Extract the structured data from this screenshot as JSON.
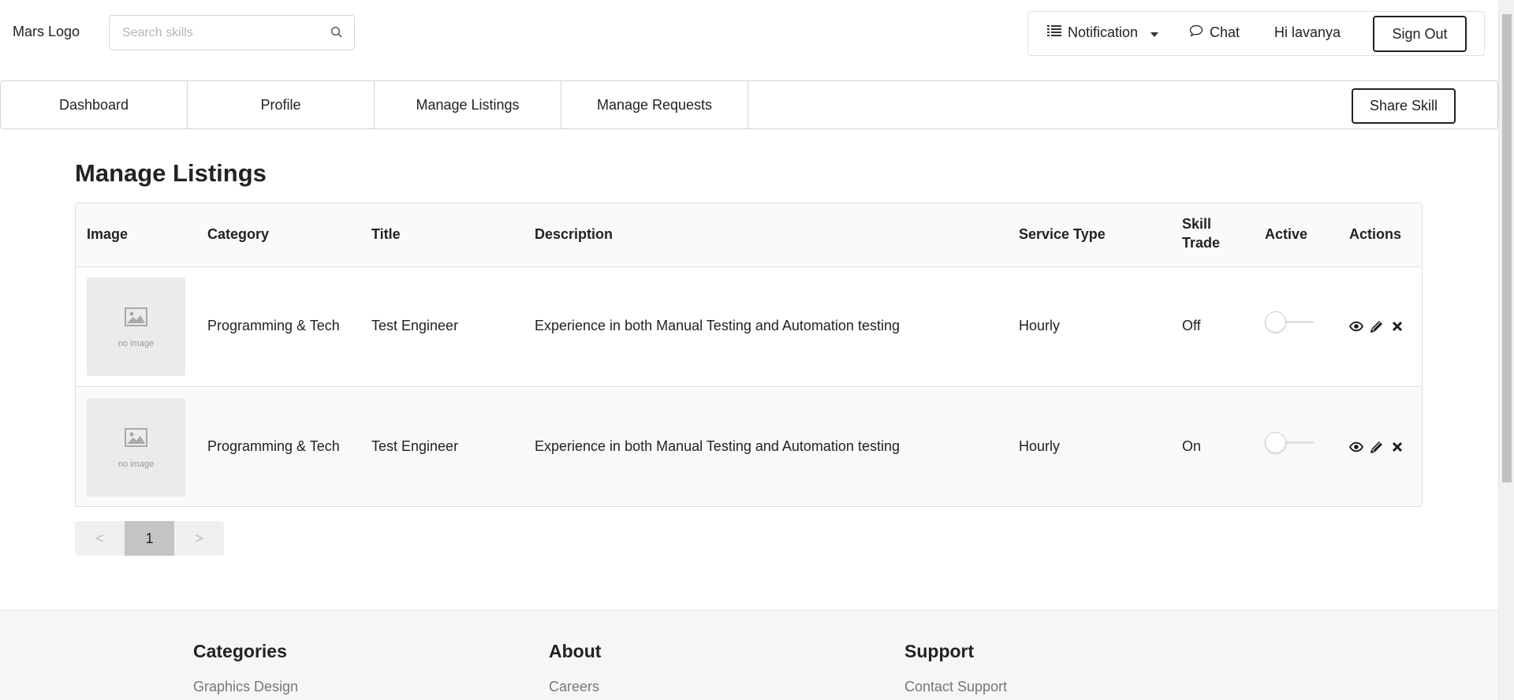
{
  "header": {
    "logo": "Mars Logo",
    "search_placeholder": "Search skills",
    "notification_label": "Notification",
    "chat_label": "Chat",
    "greeting": "Hi lavanya",
    "signout_label": "Sign Out"
  },
  "tabs": [
    {
      "label": "Dashboard"
    },
    {
      "label": "Profile"
    },
    {
      "label": "Manage Listings"
    },
    {
      "label": "Manage Requests"
    }
  ],
  "share_skill_label": "Share Skill",
  "page_title": "Manage Listings",
  "table": {
    "headers": {
      "image": "Image",
      "category": "Category",
      "title": "Title",
      "description": "Description",
      "service_type": "Service Type",
      "skill_trade_1": "Skill",
      "skill_trade_2": "Trade",
      "active": "Active",
      "actions": "Actions"
    },
    "rows": [
      {
        "image_text": "no image",
        "category": "Programming & Tech",
        "title": "Test Engineer",
        "description": "Experience in both Manual Testing and Automation testing",
        "service_type": "Hourly",
        "skill_trade": "Off",
        "active": false
      },
      {
        "image_text": "no image",
        "category": "Programming & Tech",
        "title": "Test Engineer",
        "description": "Experience in both Manual Testing and Automation testing",
        "service_type": "Hourly",
        "skill_trade": "On",
        "active": false
      }
    ]
  },
  "pagination": {
    "prev": "<",
    "current": "1",
    "next": ">"
  },
  "footer": {
    "columns": [
      {
        "heading": "Categories",
        "link": "Graphics Design"
      },
      {
        "heading": "About",
        "link": "Careers"
      },
      {
        "heading": "Support",
        "link": "Contact Support"
      }
    ]
  },
  "icons": {
    "search": "search-icon",
    "notification": "list-icon",
    "dropdown": "caret-down-icon",
    "chat": "chat-bubble-icon",
    "view": "eye-icon",
    "edit": "pencil-icon",
    "delete": "close-icon",
    "image_placeholder": "image-icon"
  }
}
